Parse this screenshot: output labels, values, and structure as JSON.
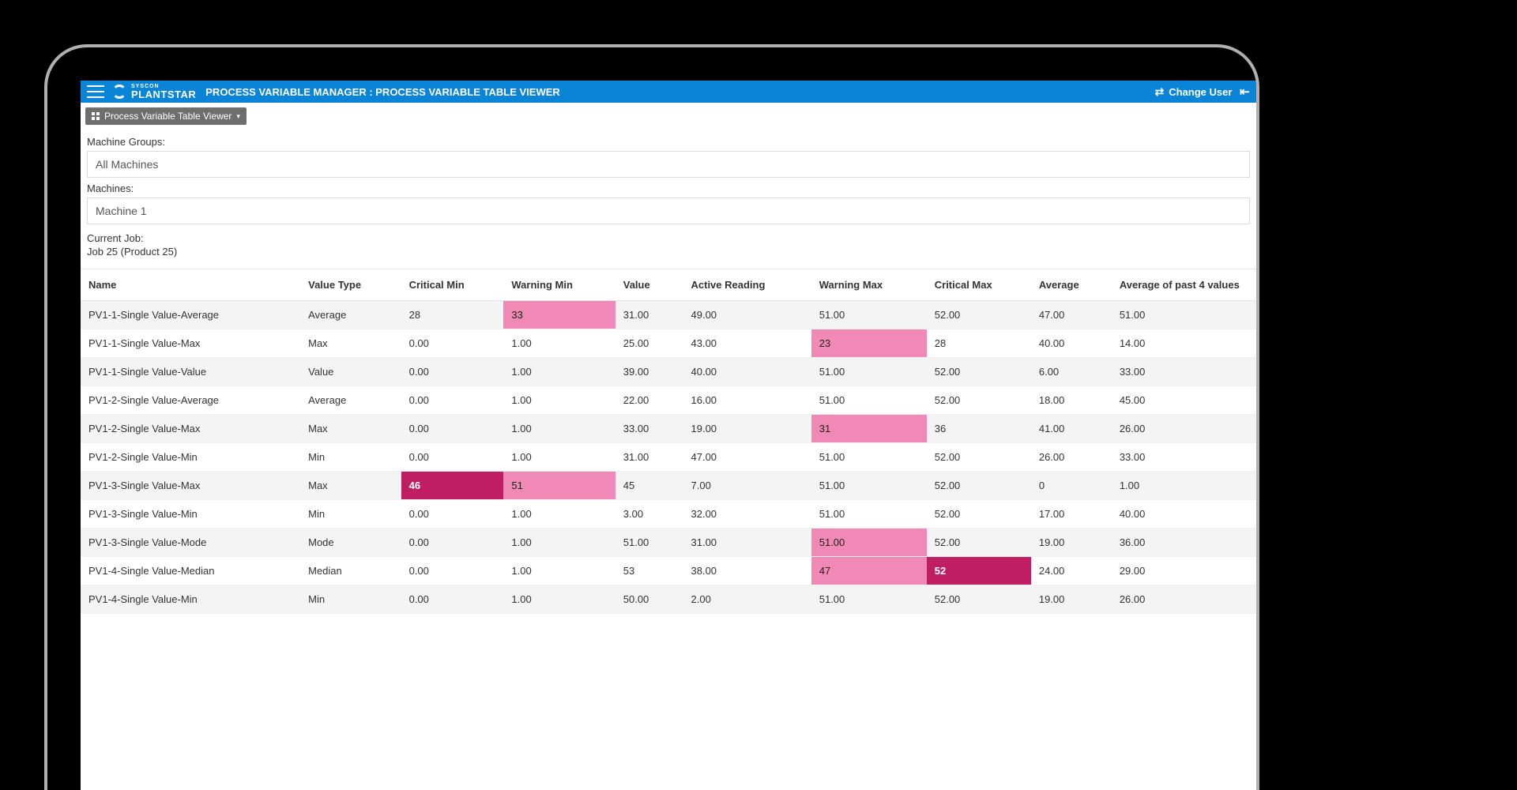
{
  "header": {
    "logo_small": "SYSCON",
    "logo_big": "PLANTSTAR",
    "title": "PROCESS VARIABLE MANAGER : PROCESS VARIABLE TABLE VIEWER",
    "change_user": "Change User"
  },
  "chip": {
    "label": "Process Variable Table Viewer"
  },
  "filters": {
    "machine_groups_label": "Machine Groups:",
    "machine_groups_value": "All Machines",
    "machines_label": "Machines:",
    "machines_value": "Machine 1",
    "current_job_label": "Current Job:",
    "current_job_value": "Job 25 (Product 25)"
  },
  "table": {
    "headers": [
      "Name",
      "Value Type",
      "Critical Min",
      "Warning Min",
      "Value",
      "Active Reading",
      "Warning Max",
      "Critical Max",
      "Average",
      "Average of past 4 values"
    ],
    "rows": [
      {
        "cells": [
          "PV1-1-Single Value-Average",
          "Average",
          "28",
          "33",
          "31.00",
          "49.00",
          "51.00",
          "52.00",
          "47.00",
          "51.00"
        ],
        "hl": {
          "3": "warn"
        }
      },
      {
        "cells": [
          "PV1-1-Single Value-Max",
          "Max",
          "0.00",
          "1.00",
          "25.00",
          "43.00",
          "23",
          "28",
          "40.00",
          "14.00"
        ],
        "hl": {
          "6": "warn"
        }
      },
      {
        "cells": [
          "PV1-1-Single Value-Value",
          "Value",
          "0.00",
          "1.00",
          "39.00",
          "40.00",
          "51.00",
          "52.00",
          "6.00",
          "33.00"
        ],
        "hl": {}
      },
      {
        "cells": [
          "PV1-2-Single Value-Average",
          "Average",
          "0.00",
          "1.00",
          "22.00",
          "16.00",
          "51.00",
          "52.00",
          "18.00",
          "45.00"
        ],
        "hl": {}
      },
      {
        "cells": [
          "PV1-2-Single Value-Max",
          "Max",
          "0.00",
          "1.00",
          "33.00",
          "19.00",
          "31",
          "36",
          "41.00",
          "26.00"
        ],
        "hl": {
          "6": "warn"
        }
      },
      {
        "cells": [
          "PV1-2-Single Value-Min",
          "Min",
          "0.00",
          "1.00",
          "31.00",
          "47.00",
          "51.00",
          "52.00",
          "26.00",
          "33.00"
        ],
        "hl": {}
      },
      {
        "cells": [
          "PV1-3-Single Value-Max",
          "Max",
          "46",
          "51",
          "45",
          "7.00",
          "51.00",
          "52.00",
          "0",
          "1.00"
        ],
        "hl": {
          "2": "crit",
          "3": "warn"
        }
      },
      {
        "cells": [
          "PV1-3-Single Value-Min",
          "Min",
          "0.00",
          "1.00",
          "3.00",
          "32.00",
          "51.00",
          "52.00",
          "17.00",
          "40.00"
        ],
        "hl": {}
      },
      {
        "cells": [
          "PV1-3-Single Value-Mode",
          "Mode",
          "0.00",
          "1.00",
          "51.00",
          "31.00",
          "51.00",
          "52.00",
          "19.00",
          "36.00"
        ],
        "hl": {
          "6": "warn"
        }
      },
      {
        "cells": [
          "PV1-4-Single Value-Median",
          "Median",
          "0.00",
          "1.00",
          "53",
          "38.00",
          "47",
          "52",
          "24.00",
          "29.00"
        ],
        "hl": {
          "6": "warn",
          "7": "crit"
        }
      },
      {
        "cells": [
          "PV1-4-Single Value-Min",
          "Min",
          "0.00",
          "1.00",
          "50.00",
          "2.00",
          "51.00",
          "52.00",
          "19.00",
          "26.00"
        ],
        "hl": {}
      }
    ]
  }
}
